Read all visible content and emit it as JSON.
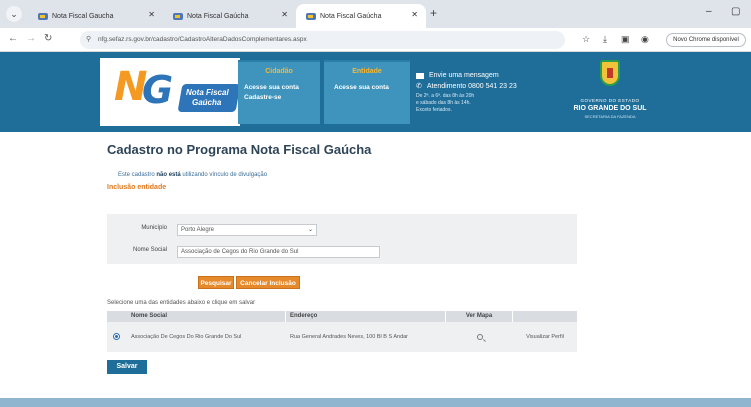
{
  "browser": {
    "tabs": [
      {
        "title": "Nota Fiscal Gaucha",
        "close": "✕"
      },
      {
        "title": "Nota Fiscal Gaúcha",
        "close": "✕"
      },
      {
        "title": "Nota Fiscal Gaúcha",
        "close": "✕"
      }
    ],
    "new_tab": "+",
    "address": "nfg.sefaz.rs.gov.br/cadastro/CadastroAlteraDadosComplementares.aspx",
    "profile_label": "Novo Chrome disponível",
    "minimize": "–",
    "maximize": "▢"
  },
  "header": {
    "logo_line1": "Nota Fiscal",
    "logo_line2": "Gaúcha",
    "cidadao": {
      "title": "Cidadão",
      "link1": "Acesse sua conta",
      "link2": "Cadastre-se"
    },
    "entidade": {
      "title": "Entidade",
      "link1": "Acesse sua conta"
    },
    "contact": {
      "message": "Envie uma mensagem",
      "phone": "Atendimento 0800 541 23 23",
      "note1": "De 2ª. a 6ª. das 8h às 20h",
      "note2": "e sábado das 8h às 14h.",
      "note3": "Exceto feriados."
    },
    "gov_small": "GOVERNO DO ESTADO",
    "gov_big": "RIO GRANDE DO SUL",
    "gov_sub": "SECRETARIA DA FAZENDA"
  },
  "page": {
    "title": "Cadastro no Programa Nota Fiscal Gaúcha",
    "info_prefix": "Este cadastro",
    "info_bold": "não está",
    "info_suffix": "utilizando vínculo de divulgação",
    "mode": "Inclusão entidade"
  },
  "form": {
    "municipio_label": "Município",
    "municipio_value": "Porto Alegre",
    "nome_label": "Nome Social",
    "nome_value": "Associação de Cegos do Rio Grande do Sul"
  },
  "actions": {
    "pesquisar": "Pesquisar",
    "cancelar": "Cancelar Inclusão",
    "salvar": "Salvar"
  },
  "grid": {
    "hint": "Selecione uma das entidades abaixo e clique em salvar",
    "headers": [
      "Nome Social",
      "Endereço",
      "Ver Mapa"
    ],
    "rows": [
      {
        "nome": "Associação De Cegos Do Rio Grande Do Sul",
        "endereco": "Rua General Andrades Neves, 100 Bl B S Andar",
        "perfil": "Visualizar Perfil"
      }
    ]
  },
  "colors": {
    "header_blue": "#1f6e9a",
    "panel_blue": "#3e94bd",
    "accent_orange": "#e5892b"
  }
}
